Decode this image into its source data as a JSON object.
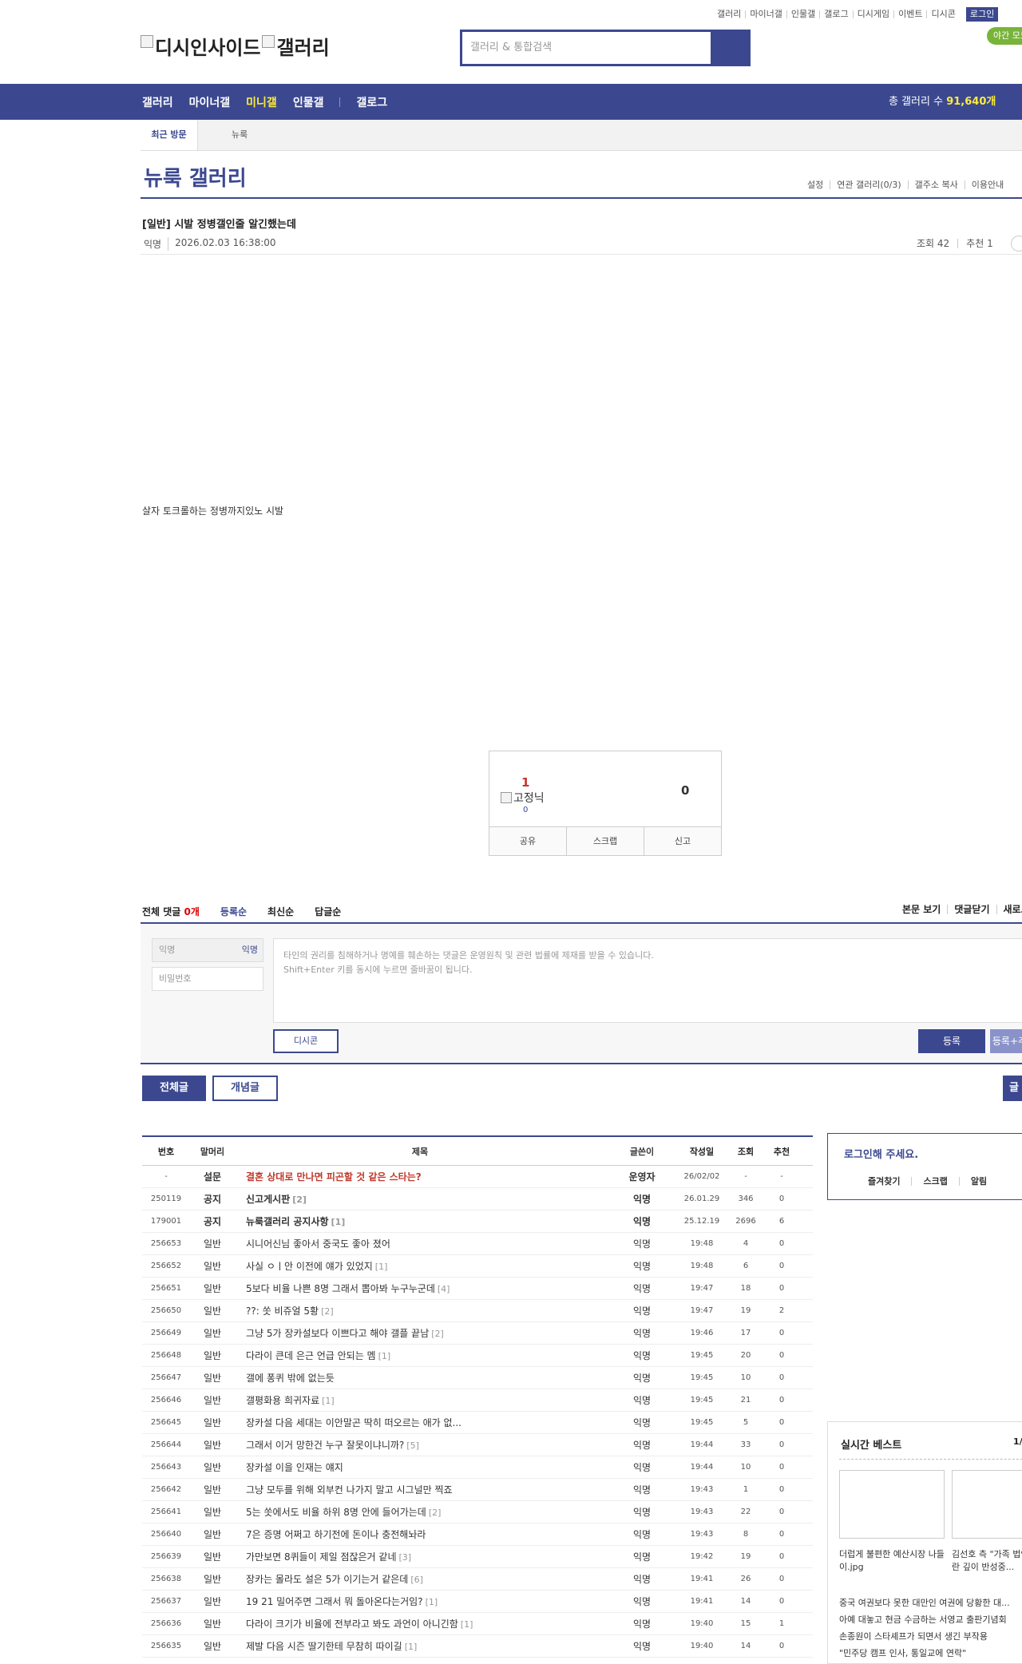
{
  "top_links": [
    "갤러리",
    "마이너갤",
    "인물갤",
    "갤로그",
    "디시게임",
    "이벤트",
    "디시콘"
  ],
  "login_label": "로그인",
  "night_mode": "야간 모드",
  "logo": {
    "part1": "디시인사이드",
    "part2": "갤러리"
  },
  "search": {
    "placeholder": "갤러리 & 통합검색"
  },
  "nav": {
    "items": [
      "갤러리",
      "마이너갤",
      "미니갤",
      "인물갤",
      "갤로그"
    ],
    "active": "미니갤",
    "total_label": "총 갤러리 수",
    "total_count": "91,640개"
  },
  "recent": {
    "label": "최근 방문",
    "visited": "뉴룩"
  },
  "gallery": {
    "title": "뉴룩 갤러리",
    "links": [
      "설정",
      "연관 갤러리(0/3)",
      "갤주소 복사",
      "이용안내"
    ]
  },
  "post": {
    "title": "[일반] 시발 정병갤인줄 알긴했는데",
    "author": "익명",
    "date": "2026.02.03 16:38:00",
    "views": "조회 42",
    "recommends": "추천 1",
    "body": "살자 토크롤하는 정병까지있노 시발"
  },
  "recommend": {
    "up": "1",
    "fix_label": "고정닉",
    "fix_count": "0",
    "down": "0",
    "actions": [
      "공유",
      "스크랩",
      "신고"
    ]
  },
  "comments": {
    "total_label": "전체 댓글",
    "total_count": "0개",
    "sort_tabs": [
      "등록순",
      "최신순",
      "답글순"
    ],
    "right_links": [
      "본문 보기",
      "댓글닫기",
      "새로고침"
    ],
    "name_placeholder": "익명",
    "name_tag": "익명",
    "password_placeholder": "비밀번호",
    "text_line1": "타인의 권리를 침해하거나 명예를 훼손하는 댓글은 운영원칙 및 관련 법률에 제재를 받을 수 있습니다.",
    "text_line2": "Shift+Enter 키를 동시에 누르면 줄바꿈이 됩니다.",
    "dccon_label": "디시콘",
    "submit_label": "등록",
    "submit2_label": "등록+추천"
  },
  "list_tabs": {
    "all": "전체글",
    "concept": "개념글",
    "right": "글쓰기"
  },
  "list": {
    "headers": {
      "num": "번호",
      "subject": "말머리",
      "title": "제목",
      "writer": "글쓴이",
      "date": "작성일",
      "views": "조회",
      "recommend": "추천"
    },
    "rows": [
      {
        "num": "-",
        "subject": "설문",
        "title": "결혼 상대로 만나면 피곤할 것 같은 스타는?",
        "count": "",
        "writer": "운영자",
        "date": "26/02/02",
        "views": "-",
        "recommend": "-",
        "type": "survey"
      },
      {
        "num": "250119",
        "subject": "공지",
        "title": "신고게시판",
        "count": "[2]",
        "writer": "익명",
        "date": "26.01.29",
        "views": "346",
        "recommend": "0",
        "type": "notice"
      },
      {
        "num": "179001",
        "subject": "공지",
        "title": "뉴룩갤러리 공지사항",
        "count": "[1]",
        "writer": "익명",
        "date": "25.12.19",
        "views": "2696",
        "recommend": "6",
        "type": "notice"
      },
      {
        "num": "256653",
        "subject": "일반",
        "title": "시니어신님 좋아서 중국도 좋아 졌어",
        "count": "",
        "writer": "익명",
        "date": "19:48",
        "views": "4",
        "recommend": "0",
        "type": "normal"
      },
      {
        "num": "256652",
        "subject": "일반",
        "title": "사실 ㅇㅣ안 이전에 얘가 있었지",
        "count": "[1]",
        "writer": "익명",
        "date": "19:48",
        "views": "6",
        "recommend": "0",
        "type": "normal"
      },
      {
        "num": "256651",
        "subject": "일반",
        "title": "5보다 비율 나쁜 8명 그래서 뽑아봐 누구누군데",
        "count": "[4]",
        "writer": "익명",
        "date": "19:47",
        "views": "18",
        "recommend": "0",
        "type": "normal"
      },
      {
        "num": "256650",
        "subject": "일반",
        "title": "??: 쏫 비쥬얼 5황",
        "count": "[2]",
        "writer": "익명",
        "date": "19:47",
        "views": "19",
        "recommend": "2",
        "type": "normal"
      },
      {
        "num": "256649",
        "subject": "일반",
        "title": "그냥 5가 장카설보다 이쁘다고 해야 갤플 끝남",
        "count": "[2]",
        "writer": "익명",
        "date": "19:46",
        "views": "17",
        "recommend": "0",
        "type": "normal"
      },
      {
        "num": "256648",
        "subject": "일반",
        "title": "다라이 큰데 은근 언급 안되는 멤",
        "count": "[1]",
        "writer": "익명",
        "date": "19:45",
        "views": "20",
        "recommend": "0",
        "type": "normal"
      },
      {
        "num": "256647",
        "subject": "일반",
        "title": "갤에 퐁퀴 밖에 없는듯",
        "count": "",
        "writer": "익명",
        "date": "19:45",
        "views": "10",
        "recommend": "0",
        "type": "normal"
      },
      {
        "num": "256646",
        "subject": "일반",
        "title": "갤평화용 희귀자료",
        "count": "[1]",
        "writer": "익명",
        "date": "19:45",
        "views": "21",
        "recommend": "0",
        "type": "normal"
      },
      {
        "num": "256645",
        "subject": "일반",
        "title": "장카설 다음 세대는 이안말곤 딱히 떠오르는 애가 없...",
        "count": "",
        "writer": "익명",
        "date": "19:45",
        "views": "5",
        "recommend": "0",
        "type": "normal"
      },
      {
        "num": "256644",
        "subject": "일반",
        "title": "그래서 이거 망한건 누구 잘못이냐니까?",
        "count": "[5]",
        "writer": "익명",
        "date": "19:44",
        "views": "33",
        "recommend": "0",
        "type": "normal"
      },
      {
        "num": "256643",
        "subject": "일반",
        "title": "장카설 이을 인재는 얘지",
        "count": "",
        "writer": "익명",
        "date": "19:44",
        "views": "10",
        "recommend": "0",
        "type": "normal"
      },
      {
        "num": "256642",
        "subject": "일반",
        "title": "그냥 모두를 위해 외부컨 나가지 말고 시그널만 찍죠",
        "count": "",
        "writer": "익명",
        "date": "19:43",
        "views": "1",
        "recommend": "0",
        "type": "normal"
      },
      {
        "num": "256641",
        "subject": "일반",
        "title": "5는 쏫에서도 비율 하위 8명 안에 들어가는데",
        "count": "[2]",
        "writer": "익명",
        "date": "19:43",
        "views": "22",
        "recommend": "0",
        "type": "normal"
      },
      {
        "num": "256640",
        "subject": "일반",
        "title": "7은 증명 어쩌고 하기전에 돈이나 충전해놔라",
        "count": "",
        "writer": "익명",
        "date": "19:43",
        "views": "8",
        "recommend": "0",
        "type": "normal"
      },
      {
        "num": "256639",
        "subject": "일반",
        "title": "가만보면 8퀴들이 제일 점잖은거 같네",
        "count": "[3]",
        "writer": "익명",
        "date": "19:42",
        "views": "19",
        "recommend": "0",
        "type": "normal"
      },
      {
        "num": "256638",
        "subject": "일반",
        "title": "장카는 몰라도 설은 5가 이기는거 같은데",
        "count": "[6]",
        "writer": "익명",
        "date": "19:41",
        "views": "26",
        "recommend": "0",
        "type": "normal"
      },
      {
        "num": "256637",
        "subject": "일반",
        "title": "19 21 밀어주면 그래서 뭐 돌아온다는거임?",
        "count": "[1]",
        "writer": "익명",
        "date": "19:41",
        "views": "14",
        "recommend": "0",
        "type": "normal"
      },
      {
        "num": "256636",
        "subject": "일반",
        "title": "다라이 크기가 비율에 전부라고 봐도 과언이 아니긴함",
        "count": "[1]",
        "writer": "익명",
        "date": "19:40",
        "views": "15",
        "recommend": "1",
        "type": "normal"
      },
      {
        "num": "256635",
        "subject": "일반",
        "title": "제발 다음 시즌 딸기한테 무참히 따이길",
        "count": "[1]",
        "writer": "익명",
        "date": "19:40",
        "views": "14",
        "recommend": "0",
        "type": "normal"
      }
    ]
  },
  "sidebar": {
    "login_title": "로그인해 주세요.",
    "login_links": [
      "즐겨찾기",
      "스크랩",
      "알림"
    ],
    "best_title": "실시간 베스트",
    "best_page": "1/",
    "best_cap1": "더럽게 불편한 예산시장 나들이.jpg",
    "best_cap2": "김선호 측 \"가족 법인...",
    "best_cap2_line2": "란 깊이 반성중...",
    "best_lines": [
      "중국 여권보다 못한 대만인 여권에 당황한 대...",
      "아예 대놓고 현금 수금하는 서영교 출판기념회",
      "손종원이 스타셰프가 되면서 생긴 부작용",
      "\"민주당 캠프 인사, 통일교에 연락\""
    ]
  }
}
